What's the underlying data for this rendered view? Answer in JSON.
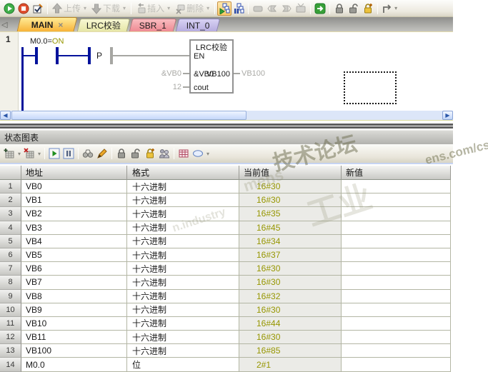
{
  "toolbar": {
    "upload_label": "上传",
    "download_label": "下载",
    "insert_label": "插入",
    "delete_label": "删除",
    "icons": [
      "run-icon",
      "stop-icon",
      "compile-check-icon",
      "upload-arrow-icon",
      "download-arrow-icon",
      "insert-icon",
      "delete-icon",
      "chart-status-run-icon",
      "chart-status-pause-icon",
      "bookmark-icon",
      "prev-bookmark-icon",
      "next-bookmark-icon",
      "clear-bookmarks-icon",
      "goto-icon",
      "lock-icon",
      "unlock-icon",
      "lock-add-icon",
      "trace-icon"
    ]
  },
  "tabs": {
    "items": [
      {
        "label": "MAIN",
        "close": "×",
        "active": true
      },
      {
        "label": "LRC校验",
        "active": false
      },
      {
        "label": "SBR_1",
        "active": false
      },
      {
        "label": "INT_0",
        "active": false
      }
    ]
  },
  "ladder": {
    "network_number": "1",
    "contact_operand": "M0.0=",
    "contact_state": "ON",
    "edge_label": "P",
    "block": {
      "title": "LRC校验",
      "pin_en": "EN",
      "pin_in1": "&VB0",
      "pin_out": "VB100",
      "pin_in2": "cout"
    },
    "monitor": {
      "in1_value": "&VB0",
      "in2_value": "12",
      "out_value": "VB100"
    }
  },
  "status_chart": {
    "title": "状态图表",
    "toolbar_icons": [
      "add-chart-icon",
      "delete-chart-icon",
      "chart-run-icon",
      "chart-pause-icon",
      "binoculars-icon",
      "pencil-icon",
      "lock-icon",
      "unlock-icon",
      "lock-add-icon",
      "witness-icon",
      "grid-icon",
      "tag-oval-icon"
    ]
  },
  "table": {
    "headers": {
      "address": "地址",
      "format": "格式",
      "current": "当前值",
      "new": "新值"
    },
    "rows": [
      {
        "num": "1",
        "address": "VB0",
        "format": "十六进制",
        "value": "16#30",
        "new_value": ""
      },
      {
        "num": "2",
        "address": "VB1",
        "format": "十六进制",
        "value": "16#30",
        "new_value": ""
      },
      {
        "num": "3",
        "address": "VB2",
        "format": "十六进制",
        "value": "16#35",
        "new_value": ""
      },
      {
        "num": "4",
        "address": "VB3",
        "format": "十六进制",
        "value": "16#45",
        "new_value": ""
      },
      {
        "num": "5",
        "address": "VB4",
        "format": "十六进制",
        "value": "16#34",
        "new_value": ""
      },
      {
        "num": "6",
        "address": "VB5",
        "format": "十六进制",
        "value": "16#37",
        "new_value": ""
      },
      {
        "num": "7",
        "address": "VB6",
        "format": "十六进制",
        "value": "16#30",
        "new_value": ""
      },
      {
        "num": "8",
        "address": "VB7",
        "format": "十六进制",
        "value": "16#30",
        "new_value": ""
      },
      {
        "num": "9",
        "address": "VB8",
        "format": "十六进制",
        "value": "16#32",
        "new_value": ""
      },
      {
        "num": "10",
        "address": "VB9",
        "format": "十六进制",
        "value": "16#30",
        "new_value": ""
      },
      {
        "num": "11",
        "address": "VB10",
        "format": "十六进制",
        "value": "16#44",
        "new_value": ""
      },
      {
        "num": "12",
        "address": "VB11",
        "format": "十六进制",
        "value": "16#30",
        "new_value": ""
      },
      {
        "num": "13",
        "address": "VB100",
        "format": "十六进制",
        "value": "16#85",
        "new_value": ""
      },
      {
        "num": "14",
        "address": "M0.0",
        "format": "位",
        "value": "2#1",
        "new_value": ""
      }
    ]
  },
  "watermarks": [
    {
      "text": "技术论坛"
    },
    {
      "text": "ens.com/cs"
    },
    {
      "text": "工业"
    },
    {
      "text": "mens"
    },
    {
      "text": "n.industry"
    }
  ]
}
